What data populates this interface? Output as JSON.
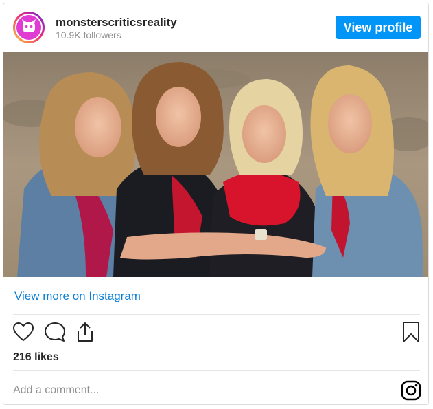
{
  "profile": {
    "username": "monsterscriticsreality",
    "followers": "10.9K followers",
    "view_profile_label": "View profile",
    "avatar_color": "#e03bd2"
  },
  "post": {
    "view_more_label": "View more on Instagram",
    "likes": "216 likes",
    "comment_placeholder": "Add a comment...",
    "icons": [
      "heart-icon",
      "comment-icon",
      "share-icon",
      "bookmark-icon",
      "instagram-icon"
    ]
  },
  "colors": {
    "accent": "#0095f6",
    "link": "#0a7fd8",
    "border": "#dbdbdb"
  }
}
